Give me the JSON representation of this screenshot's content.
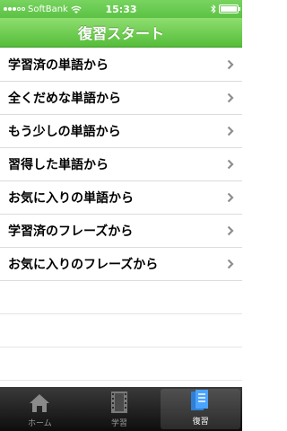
{
  "status_bar": {
    "carrier": "SoftBank",
    "time": "15:33"
  },
  "nav": {
    "title": "復習スタート"
  },
  "list": {
    "items": [
      {
        "label": "学習済の単語から"
      },
      {
        "label": "全くだめな単語から"
      },
      {
        "label": "もう少しの単語から"
      },
      {
        "label": "習得した単語から"
      },
      {
        "label": "お気に入りの単語から"
      },
      {
        "label": "学習済のフレーズから"
      },
      {
        "label": "お気に入りのフレーズから"
      }
    ]
  },
  "tab_bar": {
    "tabs": [
      {
        "label": "ホーム",
        "icon": "home-icon"
      },
      {
        "label": "学習",
        "icon": "film-icon"
      },
      {
        "label": "復習",
        "icon": "cards-icon",
        "active": true
      }
    ]
  },
  "colors": {
    "nav_green": "#5cc244",
    "tab_bar_dark": "#1a1a1a",
    "chevron": "#8e8e8e"
  }
}
